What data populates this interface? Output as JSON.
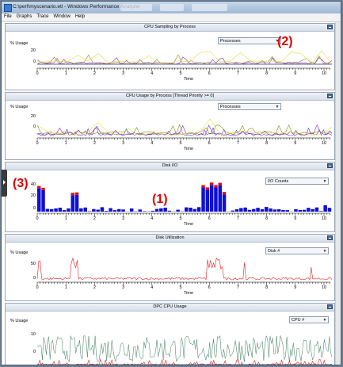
{
  "window": {
    "title": "C:\\perf\\myscenario.etl - Windows Performance Analyzer"
  },
  "menu": [
    "File",
    "Graphs",
    "Trace",
    "Window",
    "Help"
  ],
  "time_label": "Time",
  "x_ticks": [
    "0",
    "1",
    "2",
    "3",
    "4",
    "5",
    "6",
    "7",
    "8",
    "9",
    "10"
  ],
  "panels": [
    {
      "title": "CPU Sampling by Process",
      "dropdown": "Processes",
      "ylabel": "% Usage",
      "yticks": [
        "20",
        "0"
      ]
    },
    {
      "title": "CPU Usage by Process [Thread Priority >= 0]",
      "dropdown": "Processes",
      "ylabel": "% Usage",
      "yticks": [
        "20",
        "0"
      ]
    },
    {
      "title": "Disk I/O",
      "dropdown": "I/O Counts",
      "ylabel": "",
      "yticks": [
        "40",
        "20",
        "0"
      ]
    },
    {
      "title": "Disk Utilization",
      "dropdown": "Disk #",
      "ylabel": "% Usage",
      "yticks": [
        "50",
        "0"
      ]
    },
    {
      "title": "DPC CPU Usage",
      "dropdown": "CPU #",
      "ylabel": "% Usage",
      "yticks": [
        "10",
        "0"
      ]
    }
  ],
  "annotations": [
    "(1)",
    "(2)",
    "(3)"
  ],
  "colors": {
    "bar_blue": "#1010d0",
    "bar_red": "#e01010",
    "line_red": "#e02020",
    "line_green": "#3a7a5a",
    "line_purple": "#9020a0",
    "line_olive": "#8a8a20",
    "line_yellow": "#e0e040"
  }
}
